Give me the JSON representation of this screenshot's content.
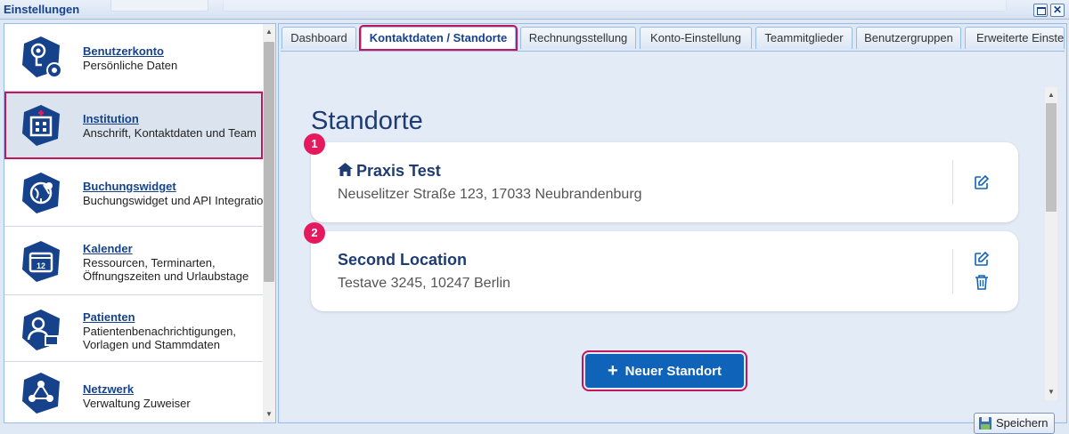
{
  "window": {
    "title": "Einstellungen"
  },
  "sidebar": {
    "items": [
      {
        "title": "Benutzerkonto",
        "subtitle": [
          "Persönliche Daten"
        ],
        "icon": "user-settings-icon",
        "active": false
      },
      {
        "title": "Institution",
        "subtitle": [
          "Anschrift, Kontaktdaten und Team"
        ],
        "icon": "hospital-icon",
        "active": true
      },
      {
        "title": "Buchungswidget",
        "subtitle": [
          "Buchungswidget und API Integration"
        ],
        "icon": "globe-widget-icon",
        "active": false
      },
      {
        "title": "Kalender",
        "subtitle": [
          "Ressourcen, Terminarten,",
          "Öffnungszeiten und Urlaubstage"
        ],
        "icon": "calendar-icon",
        "active": false
      },
      {
        "title": "Patienten",
        "subtitle": [
          "Patientenbenachrichtigungen,",
          "Vorlagen und Stammdaten"
        ],
        "icon": "patient-icon",
        "active": false
      },
      {
        "title": "Netzwerk",
        "subtitle": [
          "Verwaltung Zuweiser"
        ],
        "icon": "network-icon",
        "active": false
      }
    ]
  },
  "tabs": [
    {
      "label": "Dashboard",
      "active": false
    },
    {
      "label": "Kontaktdaten / Standorte",
      "active": true
    },
    {
      "label": "Rechnungsstellung",
      "active": false
    },
    {
      "label": "Konto-Einstellung",
      "active": false
    },
    {
      "label": "Teammitglieder",
      "active": false
    },
    {
      "label": "Benutzergruppen",
      "active": false
    },
    {
      "label": "Erweiterte Einstel",
      "active": false
    }
  ],
  "main": {
    "heading": "Standorte",
    "locations": [
      {
        "badge": "1",
        "name": "Praxis Test",
        "address": "Neuselitzer Straße 123, 17033 Neubrandenburg",
        "home": true,
        "deletable": false
      },
      {
        "badge": "2",
        "name": "Second Location",
        "address": "Testave 3245, 10247 Berlin",
        "home": false,
        "deletable": true
      }
    ],
    "add_button": "Neuer Standort",
    "save_button": "Speichern"
  },
  "colors": {
    "accent": "#15428b",
    "primary_button": "#0f63b8",
    "highlight": "#c2185b",
    "badge": "#e5195e"
  }
}
